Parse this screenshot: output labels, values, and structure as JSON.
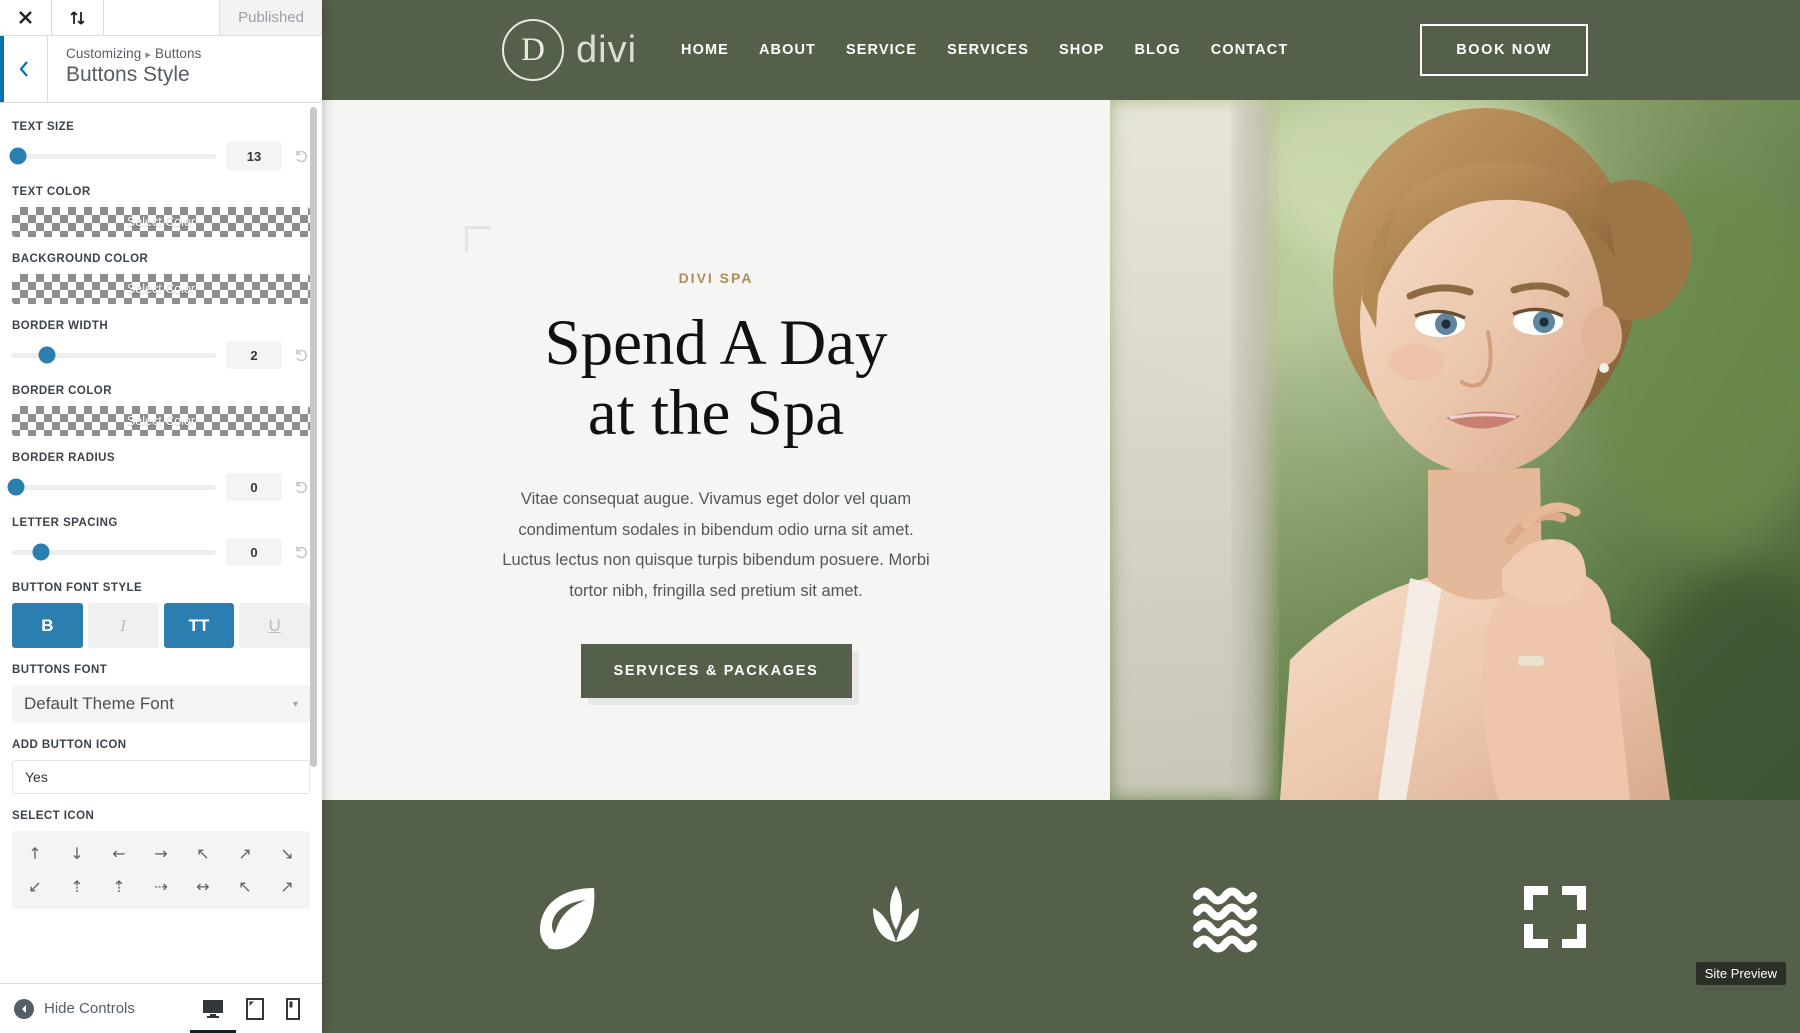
{
  "customizer": {
    "topbar": {
      "close_icon": "close-icon",
      "devices_icon": "sort-updown-icon",
      "status": "Published"
    },
    "header": {
      "back_icon": "chevron-left-icon",
      "breadcrumb_root": "Customizing",
      "breadcrumb_sep": "▸",
      "breadcrumb_current": "Buttons",
      "title": "Buttons Style"
    },
    "fields": {
      "text_size": {
        "label": "Text Size",
        "value": "13",
        "knob_pct": 3
      },
      "text_color": {
        "label": "Text Color",
        "value": "Select Color"
      },
      "background_color": {
        "label": "Background Color",
        "value": "Select Color"
      },
      "border_width": {
        "label": "Border Width",
        "value": "2",
        "knob_pct": 17
      },
      "border_color": {
        "label": "Border Color",
        "value": "Select Color"
      },
      "border_radius": {
        "label": "Border Radius",
        "value": "0",
        "knob_pct": 2
      },
      "letter_spacing": {
        "label": "Letter Spacing",
        "value": "0",
        "knob_pct": 14
      },
      "button_font_style": {
        "label": "Button Font Style",
        "options": [
          {
            "name": "bold",
            "glyph": "B",
            "active": true
          },
          {
            "name": "italic",
            "glyph": "I",
            "active": false
          },
          {
            "name": "uppercase",
            "glyph": "TT",
            "active": true
          },
          {
            "name": "underline",
            "glyph": "U",
            "active": false
          }
        ]
      },
      "buttons_font": {
        "label": "Buttons Font",
        "value": "Default Theme Font",
        "caret": "▾"
      },
      "add_button_icon": {
        "label": "Add Button Icon",
        "value": "Yes"
      },
      "select_icon": {
        "label": "Select Icon",
        "icons": [
          "↑",
          "↓",
          "←",
          "→",
          "↖",
          "↗",
          "↘",
          "↙",
          "⇡",
          "⇡",
          "⇢",
          "↔",
          "↖",
          "↗"
        ]
      }
    },
    "footer": {
      "hide_controls": "Hide Controls",
      "hide_icon": "caret-left-circle-icon",
      "devices": [
        {
          "name": "desktop",
          "active": true
        },
        {
          "name": "tablet",
          "active": false
        },
        {
          "name": "mobile",
          "active": false
        }
      ]
    }
  },
  "preview": {
    "site_header": {
      "logo_mark": "D",
      "logo_text": "divi",
      "nav": [
        "HOME",
        "ABOUT",
        "SERVICE",
        "SERVICES",
        "SHOP",
        "BLOG",
        "CONTACT"
      ],
      "cta_label": "BOOK NOW"
    },
    "hero": {
      "eyebrow": "DIVI SPA",
      "title_line1": "Spend A Day",
      "title_line2": "at the Spa",
      "paragraph": "Vitae consequat augue. Vivamus eget dolor vel quam condimentum sodales in bibendum odio urna sit amet. Luctus lectus non quisque turpis bibendum posuere. Morbi tortor nibh, fringilla sed pretium sit amet.",
      "button_label": "SERVICES & PACKAGES"
    },
    "icon_band": [
      "leaf-icon",
      "lotus-icon",
      "waves-icon",
      "corners-icon"
    ],
    "tooltip": "Site Preview"
  },
  "colors": {
    "accent_blue": "#2a7fb0",
    "brand_olive": "#55604a",
    "eyebrow_gold": "#b08d57",
    "preview_bg": "#f5f5f3"
  }
}
